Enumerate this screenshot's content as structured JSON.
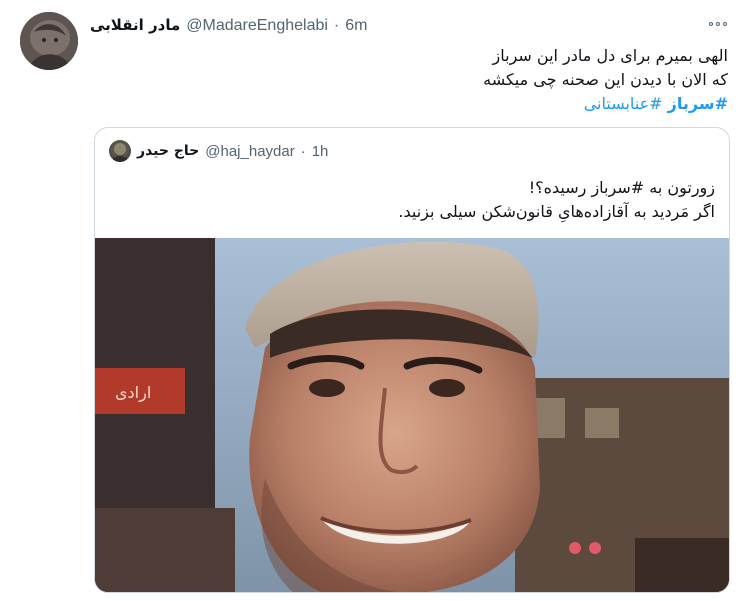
{
  "tweet": {
    "author_name": "مادر انقلابی",
    "author_handle": "@MadareEnghelabi",
    "separator": "·",
    "time": "6m",
    "text_line_1": "الهی بمیرم برای دل مادر این سرباز",
    "text_line_2": "که الان با دیدن این صحنه چی میکشه",
    "hashtag_1": "#سرباز",
    "hashtag_2": "#عنابستانی"
  },
  "quoted_tweet": {
    "author_name": "حاج حیدر",
    "author_handle": "@haj_haydar",
    "separator": "·",
    "time": "1h",
    "text_line_1": "زورتون به #سرباز رسیده؟!",
    "text_line_2": "اگر مَردید به آقازاده‌هایِ قانون‌شکن سیلی بزنید.",
    "media_background_sign": "ارادی"
  },
  "colors": {
    "link": "#1d9bf0",
    "secondary_text": "#536471",
    "border": "#cfd9de"
  },
  "icons": {
    "more": "more-horizontal-icon"
  }
}
